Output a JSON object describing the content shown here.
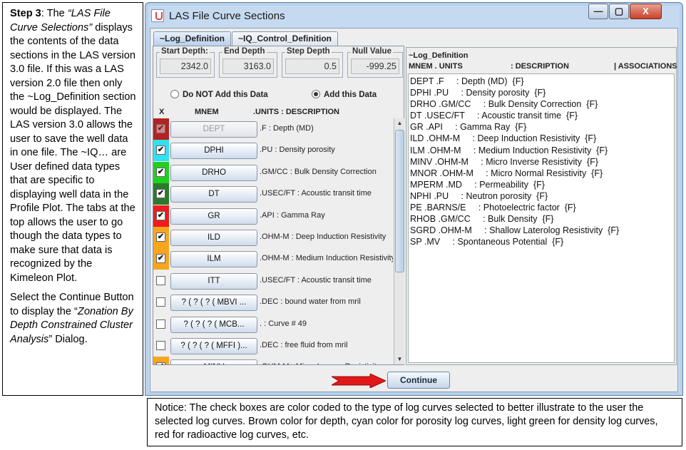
{
  "instructions": {
    "step_label": "Step 3",
    "step_sep": ": The ",
    "step_title": "“LAS File Curve Selections”",
    "p1": " displays the contents of the data sections in the LAS version 3.0 file.  If this was a LAS version 2.0 file then only the ~Log_Definition section would be displayed.   The LAS version 3.0 allows the user to save the well data in one file.  The ~IQ… are User defined data types that are specific to displaying well data in the Profile Plot.  The tabs at the top allows the user to go though the data types to make sure that data is recognized by the Kimeleon Plot.",
    "p2_pre": "Select the Continue Button to display the “",
    "p2_title": "Zonation By Depth Constrained Cluster Analysis",
    "p2_post": "” Dialog."
  },
  "notice": "Notice: The check boxes are color coded to the type of log curves selected to better illustrate to the user  the selected log curves.  Brown color for depth, cyan color for porosity log curves, light green for density log curves, red for radioactive log curves, etc.",
  "window": {
    "title": "LAS File Curve Sections",
    "min": "—",
    "max": "▢",
    "close": "X"
  },
  "tabs": [
    "~Log_Definition",
    "~IQ_Control_Definition"
  ],
  "fields": {
    "start_depth": {
      "label": "Start Depth:",
      "value": "2342.0"
    },
    "end_depth": {
      "label": "End Depth",
      "value": "3163.0"
    },
    "step_depth": {
      "label": "Step Depth",
      "value": "0.5"
    },
    "null_value": {
      "label": "Null Value",
      "value": "-999.25"
    }
  },
  "radios": {
    "no_add": "Do NOT Add this Data",
    "add": "Add this Data",
    "selected": "add"
  },
  "list_headers": {
    "x": "X",
    "mnem": "MNEM",
    "units": ".UNITS  : DESCRIPTION"
  },
  "curves": [
    {
      "mnem": "DEPT",
      "desc": ".F : Depth (MD)",
      "checked": true,
      "disabled": true,
      "color": "#b22222"
    },
    {
      "mnem": "DPHI",
      "desc": ".PU : Density porosity",
      "checked": true,
      "disabled": false,
      "color": "#33e0f0"
    },
    {
      "mnem": "DRHO",
      "desc": ".GM/CC : Bulk Density Correction",
      "checked": true,
      "disabled": false,
      "color": "#20d020"
    },
    {
      "mnem": "DT",
      "desc": ".USEC/FT : Acoustic transit time",
      "checked": true,
      "disabled": false,
      "color": "#2b7a2b"
    },
    {
      "mnem": "GR",
      "desc": ".API : Gamma Ray",
      "checked": true,
      "disabled": false,
      "color": "#ee1c1c"
    },
    {
      "mnem": "ILD",
      "desc": ".OHM-M : Deep Induction Resistivity",
      "checked": true,
      "disabled": false,
      "color": "#f7a51e"
    },
    {
      "mnem": "ILM",
      "desc": ".OHM-M : Medium Induction Resistivity",
      "checked": true,
      "disabled": false,
      "color": "#f7a51e"
    },
    {
      "mnem": "ITT",
      "desc": ".USEC/FT : Acoustic transit time",
      "checked": false,
      "disabled": false,
      "color": ""
    },
    {
      "mnem": "? ( ? ( ? ( MBVI ...",
      "desc": ".DEC : bound water from mril",
      "checked": false,
      "disabled": false,
      "color": ""
    },
    {
      "mnem": "? ( ? ( ? ( MCB...",
      "desc": ". : Curve #  49",
      "checked": false,
      "disabled": false,
      "color": ""
    },
    {
      "mnem": "? ( ? ( ? ( MFFI )...",
      "desc": ".DEC : free fluid from mril",
      "checked": false,
      "disabled": false,
      "color": ""
    },
    {
      "mnem": "MINV",
      "desc": ".OHM-M : Micro Inverse Resistivity",
      "checked": true,
      "disabled": false,
      "color": "#f7a51e"
    }
  ],
  "right_panel": {
    "title": "~Log_Definition",
    "col_mnem": "MNEM . UNITS",
    "col_desc": ": DESCRIPTION",
    "col_assoc": "| ASSOCIATIONS",
    "lines": [
      "DEPT .F     : Depth (MD)  {F}",
      "DPHI .PU     : Density porosity  {F}",
      "DRHO .GM/CC     : Bulk Density Correction  {F}",
      "DT .USEC/FT     : Acoustic transit time  {F}",
      "GR .API     : Gamma Ray  {F}",
      "ILD .OHM-M     : Deep Induction Resistivity  {F}",
      "ILM .OHM-M     : Medium Induction Resistivity  {F}",
      "MINV .OHM-M     : Micro Inverse Resistivity  {F}",
      "MNOR .OHM-M     : Micro Normal Resistivity  {F}",
      "MPERM .MD     : Permeability  {F}",
      "NPHI .PU     : Neutron porosity  {F}",
      "PE .BARNS/E     : Photoelectric factor  {F}",
      "RHOB .GM/CC     : Bulk Density  {F}",
      "SGRD .OHM-M     : Shallow Laterolog Resistivity  {F}",
      "SP .MV     : Spontaneous Potential  {F}"
    ]
  },
  "continue_label": "Continue",
  "colors": {
    "arrow": "#e01818",
    "window_frame": "#c5daf0"
  }
}
